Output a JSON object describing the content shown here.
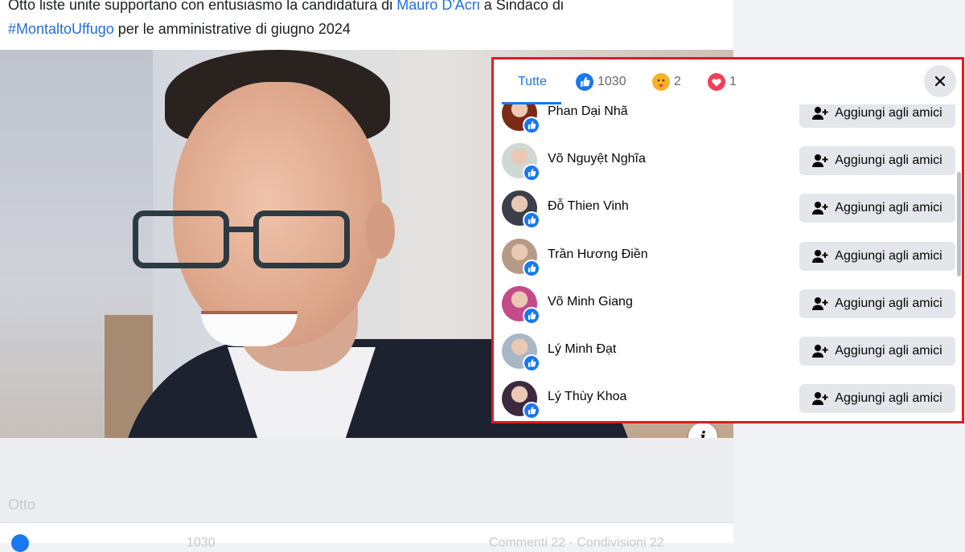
{
  "post": {
    "text_prefix": "Otto liste unite supportano con entusiasmo la candidatura di ",
    "link_name": "Mauro D'Acri",
    "text_middle": " a Sindaco di",
    "hashtag": "#MontaltoUffugo",
    "text_suffix": " per le amministrative di giugno 2024",
    "caption_faded": "Otto",
    "reaction_count_faded": "1030",
    "comments_faded": "Commenti 22 · Condivisioni 22"
  },
  "dialog": {
    "tabs": [
      {
        "label": "Tutte",
        "icon": null,
        "active": true
      },
      {
        "label": "1030",
        "icon": "like-icon",
        "active": false
      },
      {
        "label": "2",
        "icon": "care-icon",
        "active": false
      },
      {
        "label": "1",
        "icon": "love-icon",
        "active": false
      }
    ],
    "add_friend_label": "Aggiungi agli amici",
    "people": [
      {
        "name": "Phan Dại Nhã",
        "avatar_color": "#7a2b17"
      },
      {
        "name": "Võ Nguyệt Nghĩa",
        "avatar_color": "#cfd8d2"
      },
      {
        "name": "Đỗ Thien Vinh",
        "avatar_color": "#3a3f4a"
      },
      {
        "name": "Trần Hương Điền",
        "avatar_color": "#b79a86"
      },
      {
        "name": "Võ Minh Giang",
        "avatar_color": "#c34b8a"
      },
      {
        "name": "Lý Minh Đạt",
        "avatar_color": "#a9b6c6"
      },
      {
        "name": "Lý Thùy Khoa",
        "avatar_color": "#3b2a3e"
      }
    ]
  },
  "colors": {
    "accent": "#1877f2",
    "highlight_border": "#e01b24",
    "button_bg": "#e4e6eb"
  }
}
